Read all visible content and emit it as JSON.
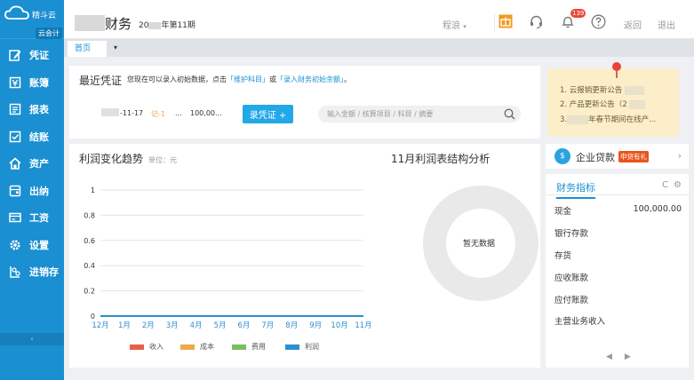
{
  "sidebar": {
    "logo_text": "精斗云",
    "logo_sub": "云会计",
    "items": [
      {
        "label": "凭证",
        "icon": "edit-icon"
      },
      {
        "label": "账簿",
        "icon": "book-icon"
      },
      {
        "label": "报表",
        "icon": "report-icon"
      },
      {
        "label": "结账",
        "icon": "checkbox-icon"
      },
      {
        "label": "资产",
        "icon": "home-icon"
      },
      {
        "label": "出纳",
        "icon": "wallet-icon"
      },
      {
        "label": "工资",
        "icon": "card-icon"
      },
      {
        "label": "设置",
        "icon": "gear-icon"
      },
      {
        "label": "进销存",
        "icon": "chain-icon"
      }
    ],
    "collapse_glyph": "‹"
  },
  "header": {
    "title": "财务",
    "period_prefix": "20",
    "period_suffix": "年第11期",
    "links": {
      "cheng_liang": "程浪",
      "back": "返回",
      "logout": "退出"
    },
    "notification_count": "139"
  },
  "tabs": {
    "items": [
      "首页"
    ],
    "more_glyph": "▾"
  },
  "voucher": {
    "title": "最近凭证",
    "hint_pre": "您现在可以录入初始数据，点击",
    "hint_link1": "「维护科目」",
    "hint_mid": "或",
    "hint_link2": "「录入财务初始余额」",
    "hint_end": "。",
    "recent": {
      "date": "-11-17",
      "num": "记-1",
      "ellipsis": "...",
      "amount": "100,00..."
    },
    "btn_label": "录凭证 +",
    "search_placeholder": "输入金额 / 核算项目 / 科目 / 摘要"
  },
  "trend": {
    "title": "利润变化趋势",
    "unit": "单位：元",
    "pie_title": "11月利润表结构分析",
    "no_data": "暂无数据"
  },
  "chart_data": {
    "type": "line",
    "title": "利润变化趋势",
    "categories": [
      "12月",
      "1月",
      "2月",
      "3月",
      "4月",
      "5月",
      "6月",
      "7月",
      "8月",
      "9月",
      "10月",
      "11月"
    ],
    "ylim": [
      0,
      1
    ],
    "yticks": [
      "0",
      "0.2",
      "0.4",
      "0.6",
      "0.8",
      "1"
    ],
    "grid": true,
    "legend_position": "bottom",
    "series": [
      {
        "name": "收入",
        "color": "#e8604c",
        "values": [
          0,
          0,
          0,
          0,
          0,
          0,
          0,
          0,
          0,
          0,
          0,
          0
        ]
      },
      {
        "name": "成本",
        "color": "#f0a74a",
        "values": [
          0,
          0,
          0,
          0,
          0,
          0,
          0,
          0,
          0,
          0,
          0,
          0
        ]
      },
      {
        "name": "费用",
        "color": "#7cbf5a",
        "values": [
          0,
          0,
          0,
          0,
          0,
          0,
          0,
          0,
          0,
          0,
          0,
          0
        ]
      },
      {
        "name": "利润",
        "color": "#2d8fcf",
        "values": [
          0,
          0,
          0,
          0,
          0,
          0,
          0,
          0,
          0,
          0,
          0,
          0
        ]
      }
    ]
  },
  "notice": {
    "items": [
      "1. 云报销更新公告",
      "2. 产品更新公告（2",
      "3.",
      "年春节期间在线产..."
    ]
  },
  "loan": {
    "label": "企业贷款",
    "badge": "申贷有礼",
    "arrow": "›"
  },
  "finance": {
    "tab": "财务指标",
    "tools": {
      "refresh": "C",
      "settings": "⚙"
    },
    "rows": [
      {
        "label": "现金",
        "value": "100,000.00"
      },
      {
        "label": "银行存款",
        "value": ""
      },
      {
        "label": "存货",
        "value": ""
      },
      {
        "label": "应收账款",
        "value": ""
      },
      {
        "label": "应付账款",
        "value": ""
      },
      {
        "label": "主营业务收入",
        "value": ""
      }
    ],
    "pager": {
      "prev": "◀",
      "next": "▶"
    }
  },
  "colors": {
    "sidebar": "#1a8fd1",
    "primary": "#22a8e8",
    "notice_bg": "#fbeec9"
  }
}
